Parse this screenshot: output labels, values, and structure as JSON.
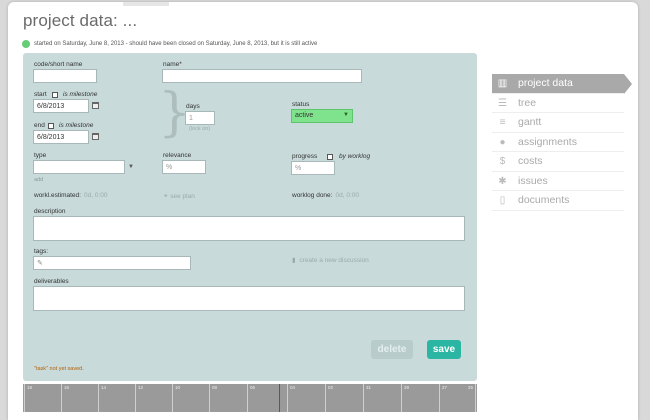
{
  "page": {
    "title": "project data: ..."
  },
  "status_line": {
    "text": "started on Saturday, June 8, 2013 - should have been closed on Saturday, June 8, 2013, but it is still active"
  },
  "form": {
    "code_label": "code/short name",
    "code_value": "",
    "name_label": "name*",
    "name_value": "",
    "start_label": "start",
    "start_milestone_label": "is milestone",
    "start_value": "6/8/2013",
    "end_label": "end",
    "end_milestone_label": "is milestone",
    "end_value": "6/8/2013",
    "days_label": "days",
    "days_value": "1",
    "days_hint": "(lock on)",
    "status_label": "status",
    "status_value": "active",
    "type_label": "type",
    "type_add_link": "add",
    "relevance_label": "relevance",
    "relevance_value": "%",
    "progress_label": "progress",
    "progress_by_worklog_label": "by worklog",
    "progress_value": "%",
    "worklog_estimated_label": "workl.estimated:",
    "worklog_estimated_value": "0d, 0:00",
    "see_plan_label": "see plan",
    "worklog_done_label": "worklog done:",
    "worklog_done_value": "0d, 0:00",
    "description_label": "description",
    "tags_label": "tags:",
    "create_discussion_label": "create a new discussion",
    "deliverables_label": "deliverables",
    "delete_label": "delete",
    "save_label": "save",
    "not_saved_text": "\"task\" not yet saved."
  },
  "sidebar": {
    "items": [
      {
        "label": "project data",
        "icon": "project-data-icon",
        "active": true
      },
      {
        "label": "tree",
        "icon": "tree-icon",
        "active": false
      },
      {
        "label": "gantt",
        "icon": "gantt-icon",
        "active": false
      },
      {
        "label": "assignments",
        "icon": "assignments-icon",
        "active": false
      },
      {
        "label": "costs",
        "icon": "costs-icon",
        "active": false
      },
      {
        "label": "issues",
        "icon": "issues-icon",
        "active": false
      },
      {
        "label": "documents",
        "icon": "documents-icon",
        "active": false
      }
    ]
  },
  "timeline": {
    "ticks": [
      "18",
      "16",
      "14",
      "12",
      "10",
      "08",
      "06",
      "04",
      "02",
      "31",
      "29",
      "27",
      "25"
    ]
  },
  "colors": {
    "panel": "#c9dada",
    "status_active": "#7ee38c",
    "save": "#2bb5a3",
    "sidebar_active": "#a9a9a9",
    "status_dot": "#66cc77"
  }
}
